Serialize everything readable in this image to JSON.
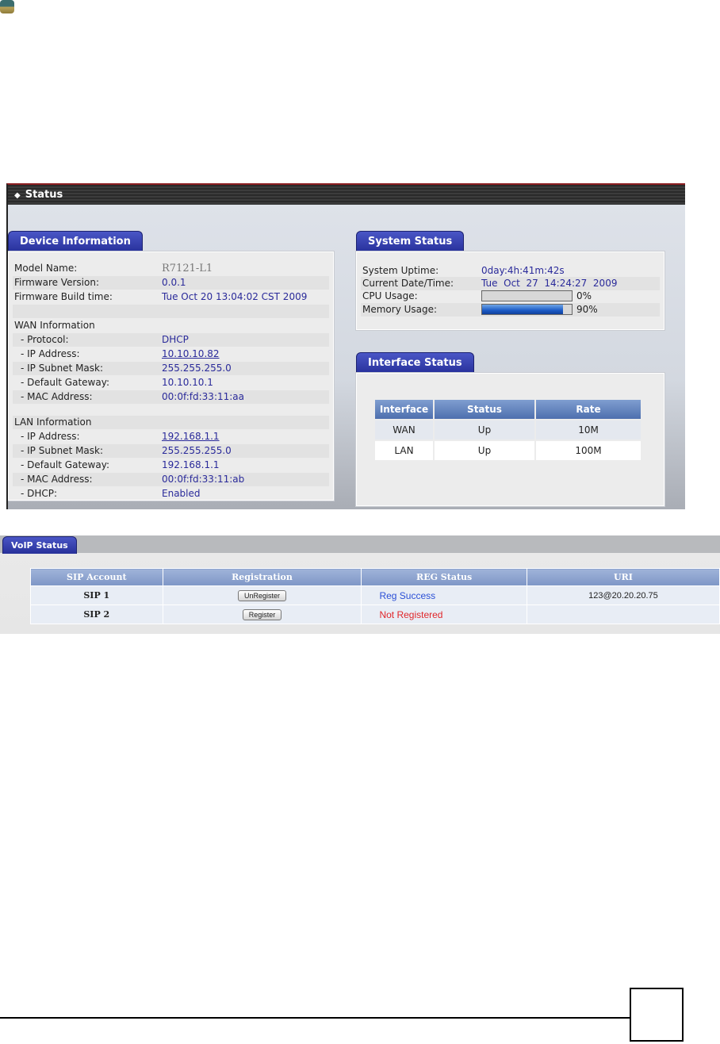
{
  "colors": {
    "accent": "#27309a",
    "header_red": "#8c1f22",
    "value_text": "#2a2a9a",
    "success": "#2a4fd6",
    "error": "#e0262a"
  },
  "icons": {
    "logo": "corner-logo-icon",
    "status_marker": "diamond-icon"
  },
  "status": {
    "title": "Status",
    "device": {
      "tab": "Device Information",
      "rows": [
        {
          "label": "Model Name:",
          "value": "R7121-L1"
        },
        {
          "label": "Firmware Version:",
          "value": "0.0.1"
        },
        {
          "label": "Firmware Build time:",
          "value": "Tue Oct 20 13:04:02 CST 2009"
        }
      ],
      "wan_heading": "WAN Information",
      "wan": [
        {
          "label": "- Protocol:",
          "value": "DHCP"
        },
        {
          "label": "- IP Address:",
          "value": "10.10.10.82"
        },
        {
          "label": "- IP Subnet Mask:",
          "value": "255.255.255.0"
        },
        {
          "label": "- Default Gateway:",
          "value": "10.10.10.1"
        },
        {
          "label": "- MAC Address:",
          "value": "00:0f:fd:33:11:aa"
        }
      ],
      "lan_heading": "LAN Information",
      "lan": [
        {
          "label": "- IP Address:",
          "value": "192.168.1.1"
        },
        {
          "label": "- IP Subnet Mask:",
          "value": "255.255.255.0"
        },
        {
          "label": "- Default Gateway:",
          "value": "192.168.1.1"
        },
        {
          "label": "- MAC Address:",
          "value": "00:0f:fd:33:11:ab"
        },
        {
          "label": "- DHCP:",
          "value": "Enabled"
        }
      ]
    },
    "system": {
      "tab": "System Status",
      "uptime_label": "System Uptime:",
      "uptime": "0day:4h:41m:42s",
      "datetime_label": "Current Date/Time:",
      "datetime": "Tue  Oct  27  14:24:27  2009",
      "cpu_label": "CPU Usage:",
      "cpu_text": "0%",
      "cpu_fraction": 0.0,
      "mem_label": "Memory Usage:",
      "mem_text": "90%",
      "mem_fraction": 0.9
    },
    "interface": {
      "tab": "Interface Status",
      "headers": [
        "Interface",
        "Status",
        "Rate"
      ],
      "rows": [
        [
          "WAN",
          "Up",
          "10M"
        ],
        [
          "LAN",
          "Up",
          "100M"
        ]
      ]
    }
  },
  "voip": {
    "tab": "VoIP Status",
    "headers": [
      "SIP Account",
      "Registration",
      "REG Status",
      "URI"
    ],
    "rows": [
      {
        "account": "SIP 1",
        "button": "UnRegister",
        "status": "Reg Success",
        "uri": "123@20.20.20.75"
      },
      {
        "account": "SIP 2",
        "button": "Register",
        "status": "Not Registered",
        "uri": ""
      }
    ]
  }
}
